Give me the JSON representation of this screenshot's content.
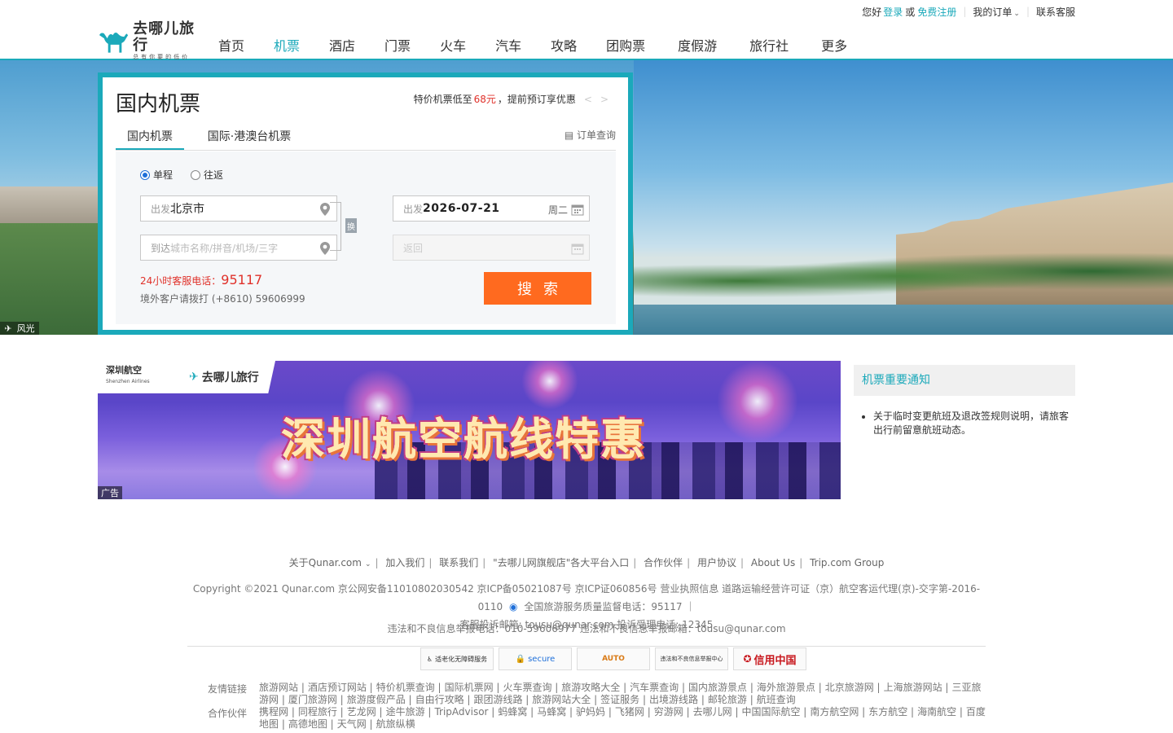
{
  "topbar": {
    "greeting": "您好",
    "login": "登录",
    "or": "或",
    "register": "免费注册",
    "my_orders": "我的订单",
    "help": "联系客服"
  },
  "logo": {
    "main": "去哪儿旅行",
    "sub": "总有你要的低价"
  },
  "nav": [
    "首页",
    "机票",
    "酒店",
    "门票",
    "火车",
    "汽车",
    "攻略",
    "团购票",
    "度假游",
    "旅行社",
    "更多"
  ],
  "hero": {
    "photo_tag": "风光"
  },
  "panel": {
    "title": "国内机票",
    "promo_prefix": "特价机票低至",
    "promo_num": "68元",
    "promo_suffix": "，提前预订享优惠",
    "tabs": [
      "国内机票",
      "国际·港澳台机票"
    ],
    "order_query": "订单查询",
    "trip_types": [
      "单程",
      "往返"
    ],
    "from_label": "出发",
    "from_value": "北京市",
    "to_label": "到达",
    "to_placeholder": "城市名称/拼音/机场/三字",
    "date_label": "出发",
    "date_value": "2026-07-21",
    "date_weekday": "周二",
    "return_label": "返回",
    "swap": "换",
    "hotline_prefix": "24小时客服电话：",
    "hotline_number": "95117",
    "intl_line": "境外客户请拨打 (+8610) 59606999",
    "search_button": "搜索"
  },
  "banner": {
    "airline_name": "深圳航空",
    "airline_en": "Shenzhen Airlines",
    "partner": "去哪儿旅行",
    "headline": "深圳航空航线特惠",
    "ad_tag": "广告"
  },
  "notice": {
    "title": "机票重要通知",
    "items": [
      "关于临时变更航班及退改签规则说明，请旅客出行前留意航班动态。"
    ]
  },
  "footer": {
    "links": [
      "关于Qunar.com",
      "加入我们",
      "联系我们",
      "\"去哪儿网旗舰店\"各大平台入口",
      "合作伙伴",
      "用户协议",
      "About Us",
      "Trip.com Group"
    ],
    "copyright_line1": "Copyright ©2021 Qunar.com  京公网安备11010802030542  京ICP备05021087号  京ICP证060856号  营业执照信息  道路运输经营许可证（京）航空客运代理(京)-交字第-2016-0110",
    "copyright_tail": "全国旅游服务质量监督电话：95117  ｜",
    "copyright_line2": "客服投诉邮箱: tousu@qunar.com   投诉受理电话: 12345",
    "complaint": "违法和不良信息举报电话：010-59606977  违法和不良信息举报邮箱：tousu@qunar.com",
    "badges": [
      "适老化无障碍服务",
      "secure",
      "AUTO",
      "违法和不良信息举报中心",
      "信用中国"
    ],
    "row1_title": "友情链接",
    "row1_items": [
      "旅游网站",
      "酒店预订网站",
      "特价机票查询",
      "国际机票网",
      "火车票查询",
      "旅游攻略大全",
      "汽车票查询",
      "国内旅游景点",
      "海外旅游景点",
      "北京旅游网",
      "上海旅游网站",
      "三亚旅游网",
      "厦门旅游网",
      "旅游度假产品",
      "自由行攻略",
      "跟团游线路",
      "旅游网站大全",
      "签证服务",
      "出境游线路",
      "邮轮旅游",
      "航班查询"
    ],
    "row2_title": "合作伙伴",
    "row2_items": [
      "携程网",
      "同程旅行",
      "艺龙网",
      "途牛旅游",
      "TripAdvisor",
      "蚂蜂窝",
      "马蜂窝",
      "驴妈妈",
      "飞猪网",
      "穷游网",
      "去哪儿网",
      "中国国际航空",
      "南方航空网",
      "东方航空",
      "海南航空",
      "百度地图",
      "高德地图",
      "天气网",
      "航旅纵横"
    ]
  }
}
